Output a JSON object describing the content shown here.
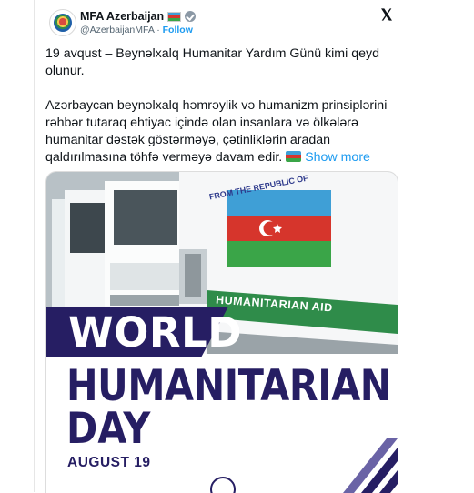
{
  "tweet": {
    "author_name": "MFA Azerbaijan",
    "handle": "@AzerbaijanMFA",
    "separator": " · ",
    "follow_label": "Follow",
    "paragraph1": "19 avqust – Beynəlxalq Humanitar Yardım Günü kimi qeyd olunur.",
    "paragraph2": "Azərbaycan beynəlxalq həmrəylik və humanizm prinsiplərini rəhbər tutaraq ehtiyac içində olan insanlara və ölkələrə humanitar dəstək göstərməyə, çətinliklərin aradan qaldırılmasına töhfə verməyə davam edir.",
    "show_more_label": "Show more",
    "icons": [
      "azerbaijan-emblem-icon",
      "azerbaijan-flag-icon",
      "verified-badge-icon",
      "x-logo-icon"
    ]
  },
  "media": {
    "truck_text_top": "FROM THE REPUBLIC OF",
    "truck_banner": "HUMANITARIAN AID",
    "headline_world": "WORLD",
    "headline_humanitarian": "HUMANITARIAN",
    "headline_day": "DAY",
    "date": "AUGUST 19"
  },
  "colors": {
    "navy": "#261e63",
    "link": "#1d9bf0",
    "flag_blue": "#3f9fd6",
    "flag_red": "#d6352c",
    "flag_green": "#3aa548"
  }
}
